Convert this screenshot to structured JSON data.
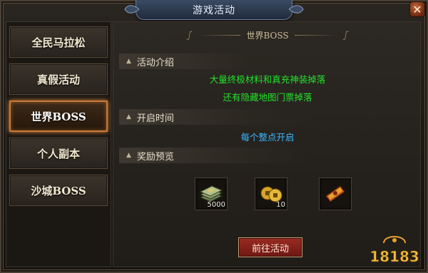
{
  "window": {
    "title": "游戏活动"
  },
  "sidebar": {
    "tabs": [
      {
        "label": "全民马拉松",
        "active": false
      },
      {
        "label": "真假活动",
        "active": false
      },
      {
        "label": "世界BOSS",
        "active": true
      },
      {
        "label": "个人副本",
        "active": false
      },
      {
        "label": "沙城BOSS",
        "active": false
      }
    ]
  },
  "content": {
    "header": "世界BOSS",
    "sections": {
      "intro": {
        "title": "活动介绍",
        "lines": [
          "大量终极材料和真充神装掉落",
          "还有隐藏地图门票掉落"
        ]
      },
      "time": {
        "title": "开启时间",
        "text": "每个整点开启"
      },
      "rewards": {
        "title": "奖励预览",
        "items": [
          {
            "icon": "money-stack-icon",
            "qty": "5000"
          },
          {
            "icon": "gold-coins-icon",
            "qty": "10"
          },
          {
            "icon": "ticket-scroll-icon",
            "qty": ""
          }
        ]
      }
    },
    "go_button": "前往活动"
  },
  "watermark": {
    "text": "18183"
  },
  "colors": {
    "accent_tab": "#c8793a",
    "intro_text": "#22e02a",
    "time_text": "#38b8ff",
    "button": "#9a2a22"
  }
}
